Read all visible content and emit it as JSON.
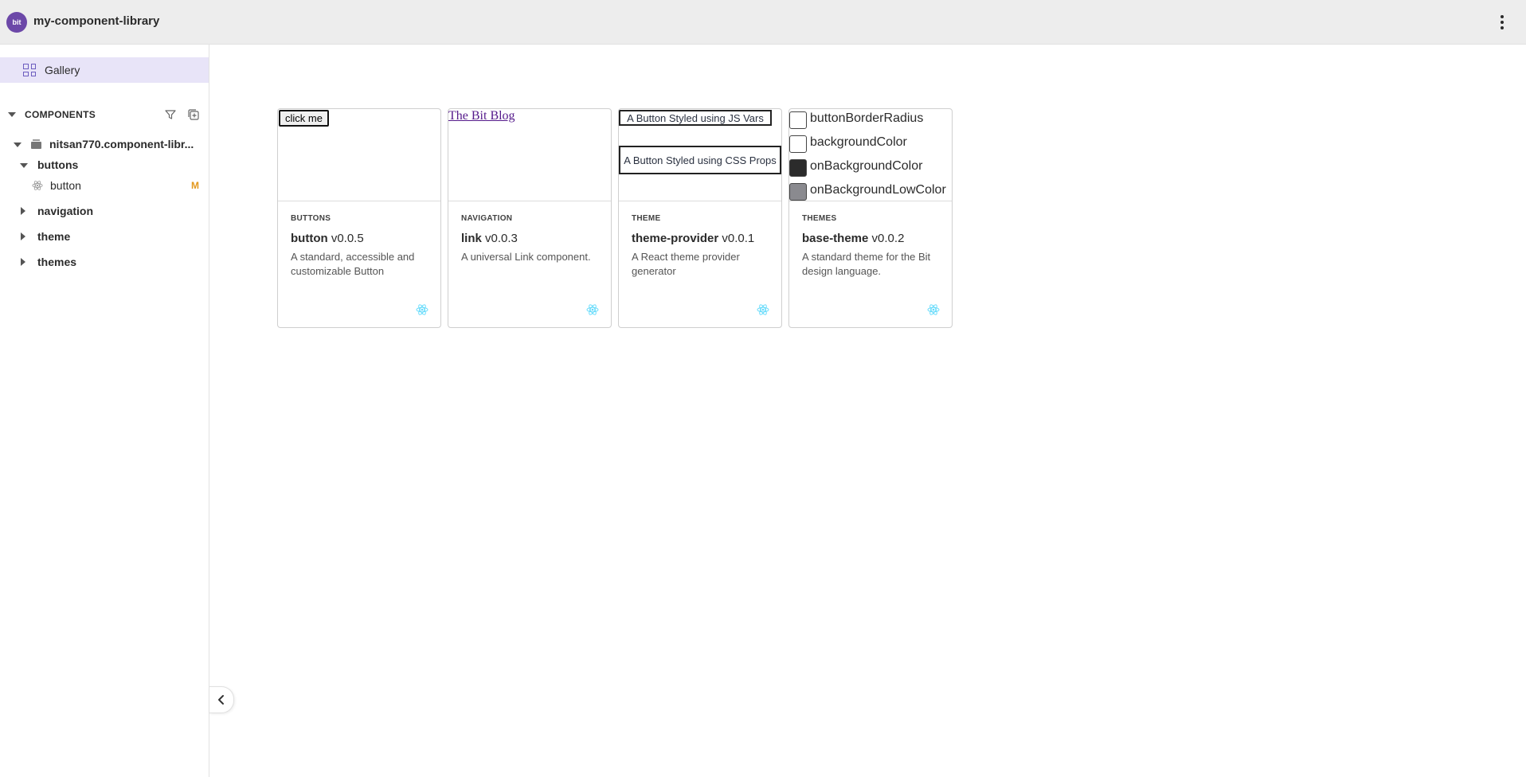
{
  "app": {
    "logo_text": "bit",
    "scope_name": "my-component-library"
  },
  "sidebar": {
    "gallery_label": "Gallery",
    "components_title": "COMPONENTS",
    "tree": {
      "scope": "nitsan770.component-libr...",
      "buttons": "buttons",
      "button": "button",
      "button_badge": "M",
      "navigation": "navigation",
      "theme": "theme",
      "themes": "themes"
    }
  },
  "cards": [
    {
      "namespace": "BUTTONS",
      "name": "button",
      "version": "v0.0.5",
      "description": "A standard, accessible and customizable Button",
      "preview": {
        "button_label": "click me"
      }
    },
    {
      "namespace": "NAVIGATION",
      "name": "link",
      "version": "v0.0.3",
      "description": "A universal Link component.",
      "preview": {
        "link_text": "The Bit Blog"
      }
    },
    {
      "namespace": "THEME",
      "name": "theme-provider",
      "version": "v0.0.1",
      "description": "A React theme provider generator",
      "preview": {
        "js_button": "A Button Styled using JS Vars",
        "css_button": "A Button Styled using CSS Props"
      }
    },
    {
      "namespace": "THEMES",
      "name": "base-theme",
      "version": "v0.0.2",
      "description": "A standard theme for the Bit design language.",
      "preview": {
        "swatches": [
          {
            "label": "buttonBorderRadius",
            "color": "#ffffff"
          },
          {
            "label": "backgroundColor",
            "color": "#ffffff"
          },
          {
            "label": "onBackgroundColor",
            "color": "#2b2b2b"
          },
          {
            "label": "onBackgroundLowColor",
            "color": "#8a8a8f"
          }
        ]
      }
    }
  ],
  "colors": {
    "accent": "#6c48a8",
    "gallery_highlight": "#e8e4f8",
    "modified_badge": "#e3981c",
    "react": "#61dafb"
  },
  "icons": {
    "menu": "kebab-icon",
    "filter": "filter-icon",
    "add": "add-component-icon",
    "collapse": "chevron-left-icon",
    "framework": "react-icon"
  }
}
